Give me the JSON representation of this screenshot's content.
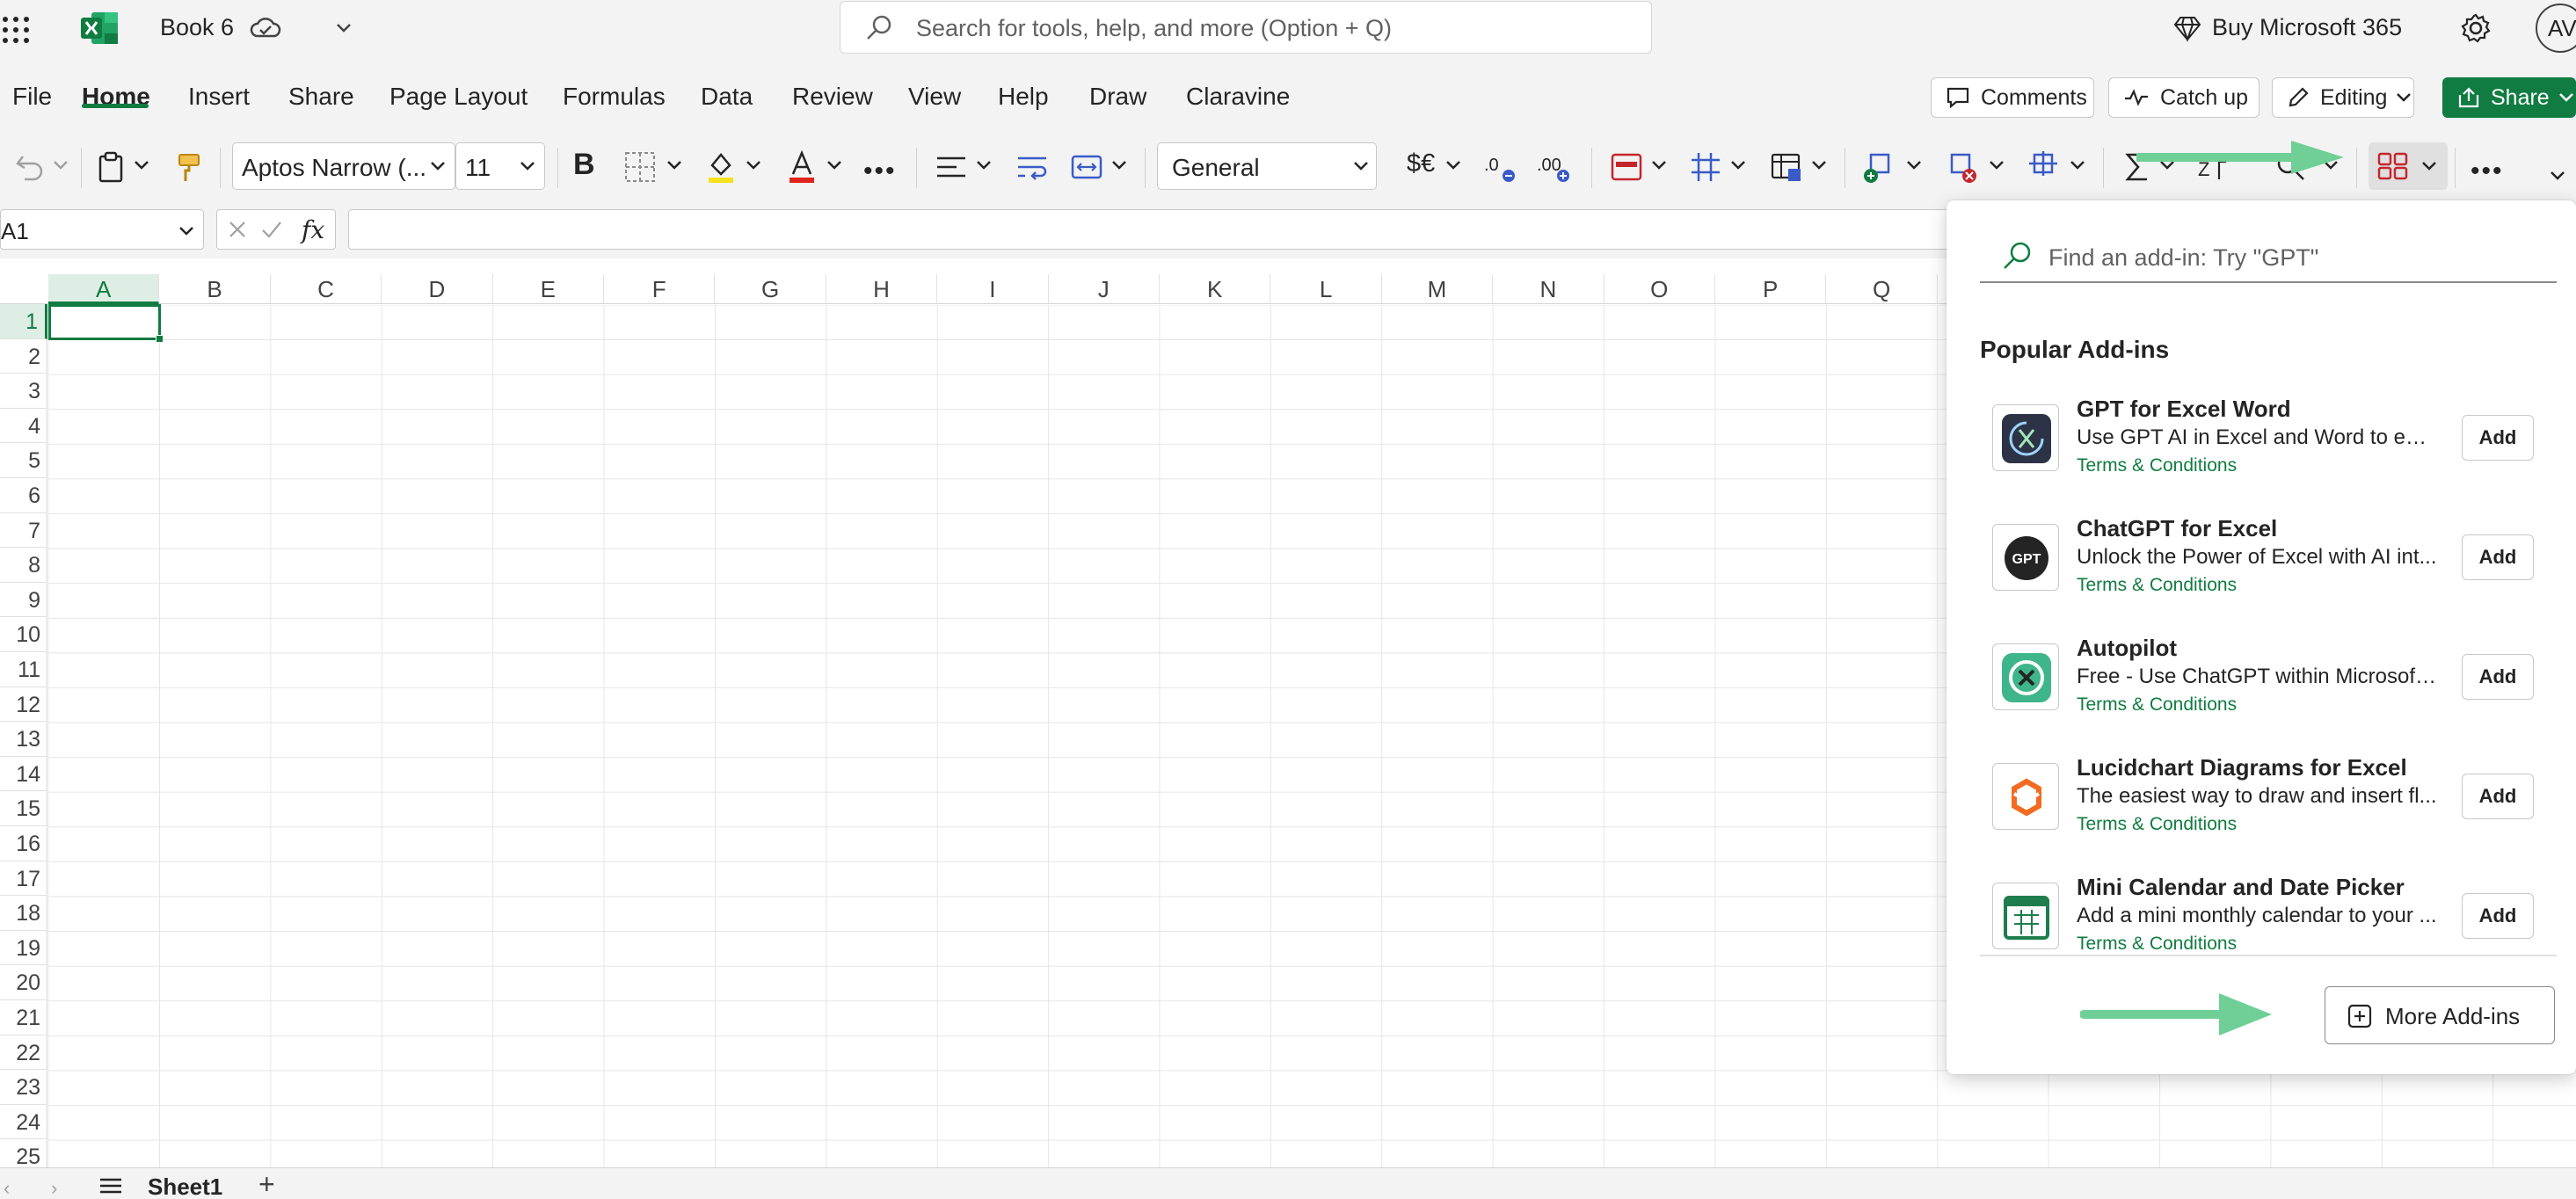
{
  "app": {
    "book_title": "Book 6",
    "search_placeholder": "Search for tools, help, and more (Option + Q)",
    "buy_label": "Buy Microsoft 365",
    "avatar_initials": "AV",
    "brand_color": "#107c41"
  },
  "tabs": [
    "File",
    "Home",
    "Insert",
    "Share",
    "Page Layout",
    "Formulas",
    "Data",
    "Review",
    "View",
    "Help",
    "Draw",
    "Claravine"
  ],
  "active_tab": "Home",
  "toolbar": {
    "comments_label": "Comments",
    "catchup_label": "Catch up",
    "editing_label": "Editing",
    "share_label": "Share"
  },
  "ribbon": {
    "font_name": "Aptos Narrow (...",
    "font_size": "11",
    "number_format": "General",
    "currency_symbol": "$€",
    "bold_glyph": "B"
  },
  "formula_bar": {
    "name_box": "A1",
    "fx_glyph": "fx"
  },
  "grid": {
    "columns": [
      "A",
      "B",
      "C",
      "D",
      "E",
      "F",
      "G",
      "H",
      "I",
      "J",
      "K",
      "L",
      "M",
      "N",
      "O",
      "P",
      "Q"
    ],
    "rows": [
      "1",
      "2",
      "3",
      "4",
      "5",
      "6",
      "7",
      "8",
      "9",
      "10",
      "11",
      "12",
      "13",
      "14",
      "15",
      "16",
      "17",
      "18",
      "19",
      "20",
      "21",
      "22",
      "23",
      "24",
      "25"
    ],
    "active_cell": "A1"
  },
  "sheet": {
    "tab_label": "Sheet1",
    "add_glyph": "+"
  },
  "addins_panel": {
    "search_placeholder": "Find an add-in: Try \"GPT\"",
    "section_title": "Popular Add-ins",
    "items": [
      {
        "name": "GPT for Excel Word",
        "description": "Use GPT AI in Excel and Word to edi...",
        "terms": "Terms & Conditions",
        "add_label": "Add",
        "icon": "gpt-word-icon"
      },
      {
        "name": "ChatGPT for Excel",
        "description": "Unlock the Power of Excel with AI int...",
        "terms": "Terms & Conditions",
        "add_label": "Add",
        "icon": "chatgpt-icon",
        "logo_text": "GPT"
      },
      {
        "name": "Autopilot",
        "description": "Free - Use ChatGPT within Microsoft...",
        "terms": "Terms & Conditions",
        "add_label": "Add",
        "icon": "autopilot-icon"
      },
      {
        "name": "Lucidchart Diagrams for Excel",
        "description": "The easiest way to draw and insert fl...",
        "terms": "Terms & Conditions",
        "add_label": "Add",
        "icon": "lucidchart-icon"
      },
      {
        "name": "Mini Calendar and Date Picker",
        "description": "Add a mini monthly calendar to your ...",
        "terms": "Terms & Conditions",
        "add_label": "Add",
        "icon": "calendar-icon"
      }
    ],
    "more_label": "More Add-ins"
  },
  "annotations": {
    "arrow_color": "#6fcf97"
  }
}
